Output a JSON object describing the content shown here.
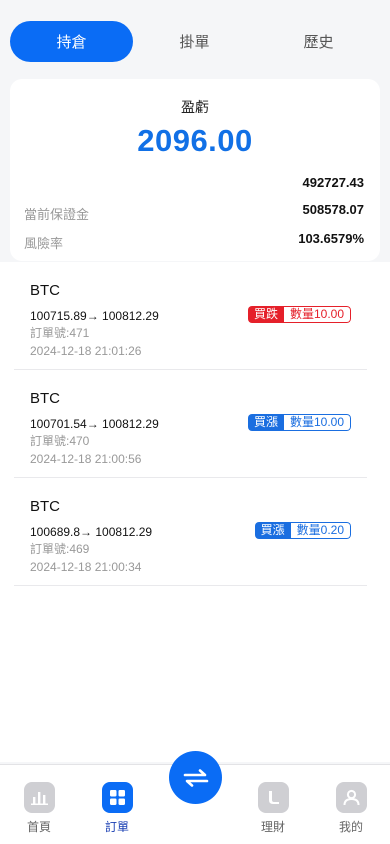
{
  "tabs": [
    {
      "label": "持倉",
      "active": true
    },
    {
      "label": "掛單",
      "active": false
    },
    {
      "label": "歷史",
      "active": false
    }
  ],
  "summary": {
    "label": "盈虧",
    "value": "2096.00",
    "rows": [
      {
        "key": "",
        "value": "492727.43"
      },
      {
        "key": "當前保證金",
        "value": "508578.07"
      },
      {
        "key": "風險率",
        "value": "103.6579%"
      }
    ]
  },
  "positions": [
    {
      "symbol": "BTC",
      "price": "100715.89→ 100812.29",
      "order": "訂單號:471",
      "time": "2024-12-18 21:01:26",
      "side": "買跌",
      "qty": "數量10.00"
    },
    {
      "symbol": "BTC",
      "price": "100701.54→ 100812.29",
      "order": "訂單號:470",
      "time": "2024-12-18 21:00:56",
      "side": "買漲",
      "qty": "數量10.00"
    },
    {
      "symbol": "BTC",
      "price": "100689.8→ 100812.29",
      "order": "訂單號:469",
      "time": "2024-12-18 21:00:34",
      "side": "買漲",
      "qty": "數量0.20"
    }
  ],
  "nav": {
    "items": [
      {
        "label": "首頁",
        "icon": "chart-icon"
      },
      {
        "label": "訂單",
        "icon": "grid-icon"
      },
      {
        "label": "理財",
        "icon": "wallet-icon"
      },
      {
        "label": "我的",
        "icon": "user-icon"
      }
    ],
    "center_icon": "swap-icon"
  },
  "colors": {
    "accent": "#0a6cf5",
    "profit": "#1170e6",
    "sell": "#e5202a",
    "buy": "#1a6ee0"
  }
}
